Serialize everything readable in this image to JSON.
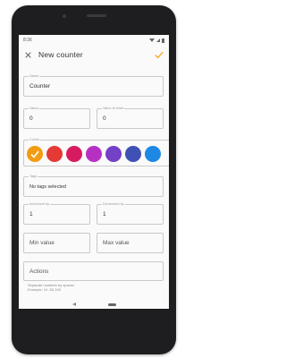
{
  "status": {
    "time": "8:36"
  },
  "toolbar": {
    "title": "New counter"
  },
  "form": {
    "name": {
      "label": "Name",
      "value": "Counter"
    },
    "value": {
      "label": "Value",
      "value": "0"
    },
    "value_at_reset": {
      "label": "Value at reset",
      "value": "0"
    },
    "colors": {
      "label": "Colors",
      "swatches": [
        {
          "name": "orange",
          "color": "#f39c12",
          "selected": true
        },
        {
          "name": "red",
          "color": "#e53935",
          "selected": false
        },
        {
          "name": "pink",
          "color": "#d81b60",
          "selected": false
        },
        {
          "name": "purple",
          "color": "#b730c4",
          "selected": false
        },
        {
          "name": "deep-purple",
          "color": "#7340c6",
          "selected": false
        },
        {
          "name": "indigo",
          "color": "#3f51b5",
          "selected": false
        },
        {
          "name": "blue",
          "color": "#1e88e5",
          "selected": false
        }
      ]
    },
    "tags": {
      "label": "Tags",
      "value": "No tags selected"
    },
    "increment": {
      "label": "Increment by",
      "value": "1"
    },
    "decrement": {
      "label": "Decrement by",
      "value": "1"
    },
    "min_value": {
      "placeholder": "Min value"
    },
    "max_value": {
      "placeholder": "Max value"
    },
    "actions": {
      "placeholder": "Actions",
      "hint_line1": "Separate numbers by spaces",
      "hint_line2": "Example: 10 -50 100"
    }
  },
  "colors": {
    "accent": "#f5a623",
    "icon": "#555555"
  }
}
